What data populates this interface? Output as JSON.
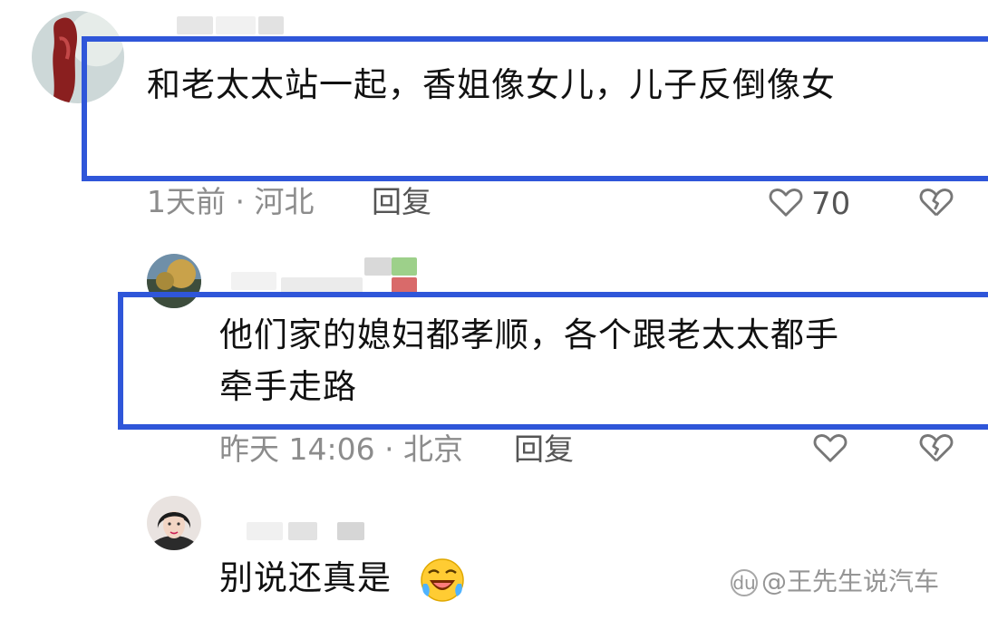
{
  "comments": [
    {
      "text": "和老太太站一起，香姐像女儿，儿子反倒像女",
      "time_location": "1天前 · 河北",
      "reply_label": "回复",
      "like_count": "70"
    },
    {
      "text_line1": "他们家的媳妇都孝顺，各个跟老太太都手",
      "text_line2": "牵手走路",
      "time_location": "昨天 14:06 · 北京",
      "reply_label": "回复"
    },
    {
      "text": "别说还真是"
    }
  ],
  "watermark": {
    "icon_text": "du",
    "text": "@王先生说汽车"
  },
  "colors": {
    "highlight_border": "#2f56d9",
    "meta_text": "#8c8c8c"
  },
  "icons": [
    "heart-icon",
    "broken-heart-icon",
    "laughing-emoji"
  ]
}
